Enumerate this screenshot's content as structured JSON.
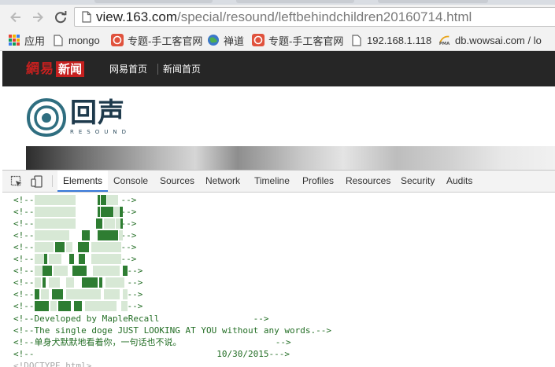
{
  "browser": {
    "url_host": "view.163.com",
    "url_path": "/special/resound/leftbehindchildren20160714.html",
    "bookmarks": [
      {
        "label": "应用",
        "icon": "apps-grid-icon"
      },
      {
        "label": "mongo",
        "icon": "page-icon"
      },
      {
        "label": "专题-手工客官网",
        "icon": "red-site-icon"
      },
      {
        "label": "禅道",
        "icon": "globe-icon"
      },
      {
        "label": "专题-手工客官网",
        "icon": "red-site-icon"
      },
      {
        "label": "192.168.1.118",
        "icon": "page-icon"
      },
      {
        "label": "db.wowsai.com / lo",
        "icon": "pma-icon"
      }
    ]
  },
  "site": {
    "logo_part1": "網易",
    "logo_part2": "新闻",
    "nav": [
      "网易首页",
      "新闻首页"
    ],
    "brand_cn": "回声",
    "brand_en": "RESOUND",
    "brand_color": "#1e3a4c",
    "header_bg": "#262626",
    "accent_red": "#c6201f"
  },
  "devtools": {
    "tabs": [
      "Elements",
      "Console",
      "Sources",
      "Network",
      "Timeline",
      "Profiles",
      "Resources",
      "Security",
      "Audits"
    ],
    "active_tab": "Elements",
    "comment_open": "<!--",
    "comment_close": "-->",
    "art_rows": 10,
    "credit_lines": [
      "<!--Developed by MapleRecall                  -->",
      "<!--The single doge JUST LOOKING AT YOU without any words.-->",
      "<!--单身犬默默地看着你，一句话也不说。                  -->",
      "<!--                                   10/30/2015--->"
    ],
    "doctype": "<!DOCTYPE html>",
    "comment_color": "#236e25",
    "art_dark": "#2e7d32",
    "art_light": "#d7e8d5"
  }
}
